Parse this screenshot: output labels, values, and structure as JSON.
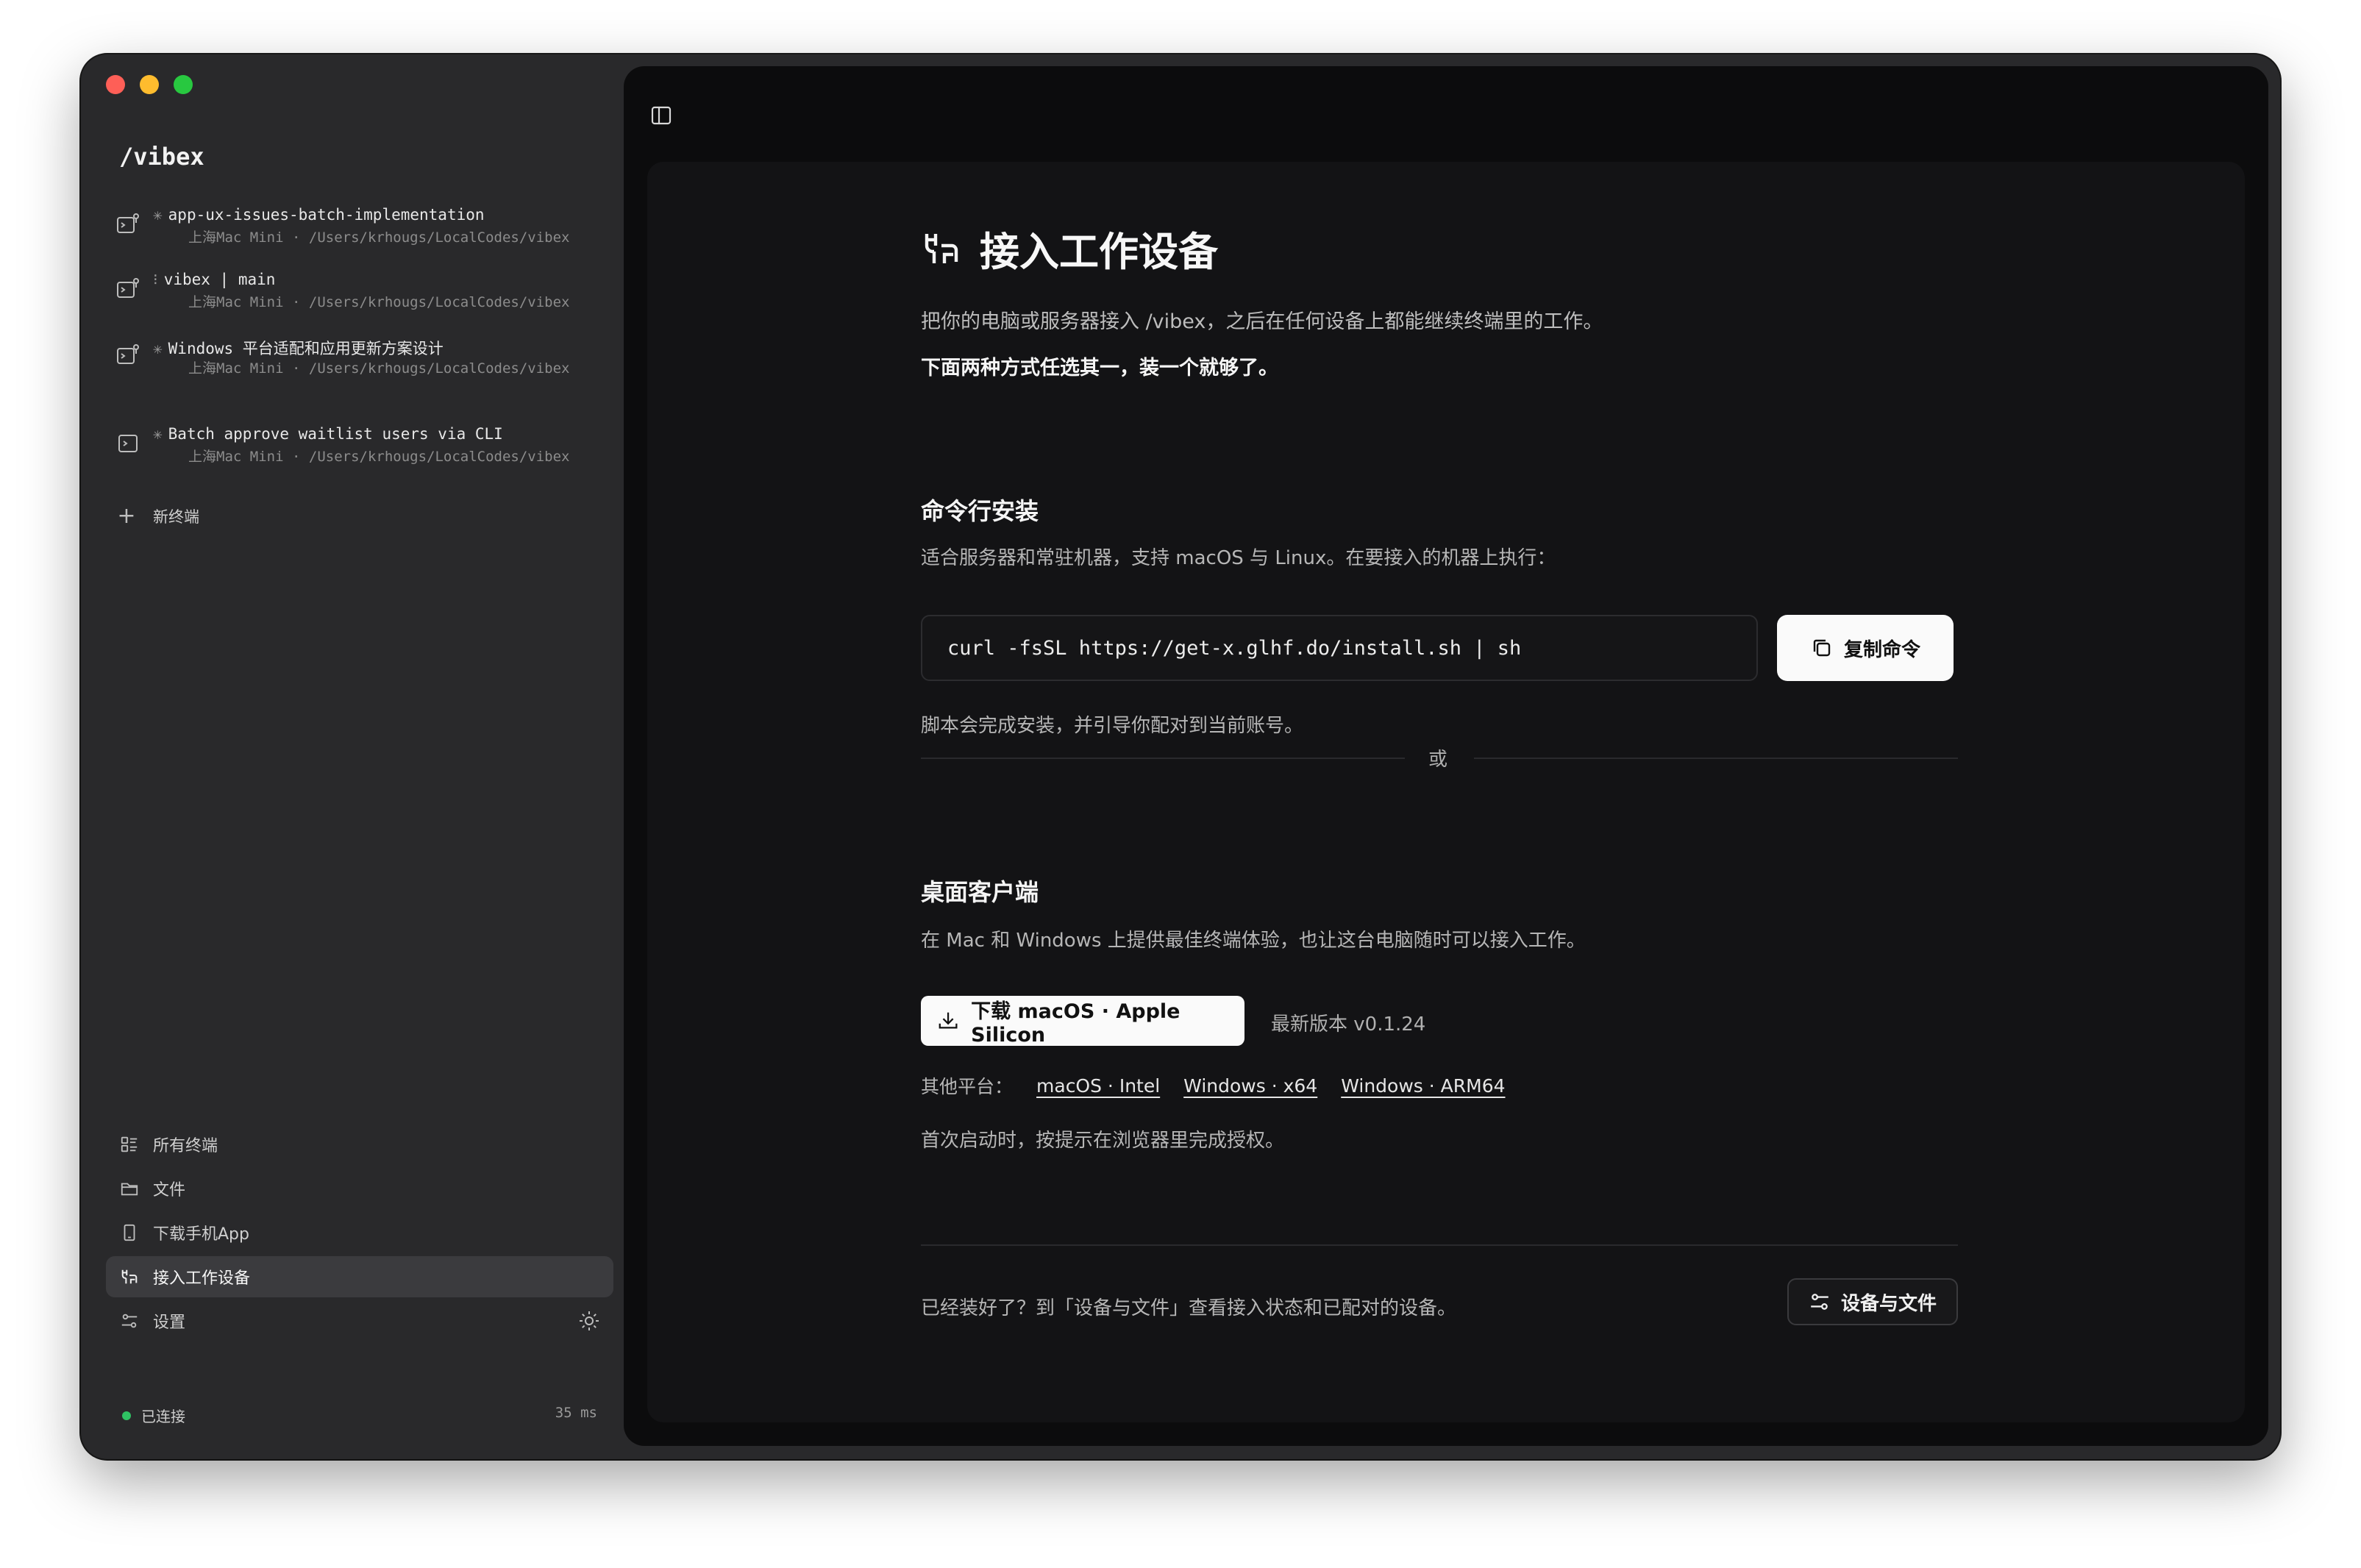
{
  "app": {
    "brand": "/vibex"
  },
  "sidebar": {
    "sessions": [
      {
        "icon": "terminal-branch-icon",
        "mark": "✳",
        "title": "app-ux-issues-batch-implementation",
        "host": "上海Mac Mini",
        "path": "/Users/krhougs/LocalCodes/vibex"
      },
      {
        "icon": "terminal-branch-icon",
        "mark": "⁝",
        "title": "vibex | main",
        "host": "上海Mac Mini",
        "path": "/Users/krhougs/LocalCodes/vibex"
      },
      {
        "icon": "terminal-branch-icon",
        "mark": "✳",
        "title": "Windows 平台适配和应用更新方案设计",
        "host": "上海Mac Mini",
        "path": "/Users/krhougs/LocalCodes/vibex"
      },
      {
        "icon": "terminal-icon",
        "mark": "✳",
        "title": "Batch approve waitlist users via CLI",
        "host": "上海Mac Mini",
        "path": "/Users/krhougs/LocalCodes/vibex"
      }
    ],
    "meta_separator": "·",
    "new_terminal": "新终端",
    "nav": [
      {
        "label": "所有终端",
        "icon": "list-icon"
      },
      {
        "label": "文件",
        "icon": "folder-icon"
      },
      {
        "label": "下载手机App",
        "icon": "phone-icon"
      },
      {
        "label": "接入工作设备",
        "icon": "connect-device-icon",
        "active": true
      },
      {
        "label": "设置",
        "icon": "settings-sliders-icon"
      }
    ],
    "status": {
      "label": "已连接",
      "latency": "35 ms",
      "color": "#2fc263"
    }
  },
  "main": {
    "title": "接入工作设备",
    "lead": "把你的电脑或服务器接入 /vibex，之后在任何设备上都能继续终端里的工作。",
    "lead_bold": "下面两种方式任选其一，装一个就够了。",
    "cli": {
      "title": "命令行安装",
      "desc": "适合服务器和常驻机器，支持 macOS 与 Linux。在要接入的机器上执行：",
      "command": "curl -fsSL https://get-x.glhf.do/install.sh | sh",
      "copy_label": "复制命令",
      "note": "脚本会完成安装，并引导你配对到当前账号。"
    },
    "or_label": "或",
    "desktop": {
      "title": "桌面客户端",
      "desc": "在 Mac 和 Windows 上提供最佳终端体验，也让这台电脑随时可以接入工作。",
      "download_label": "下载 macOS · Apple Silicon",
      "version_label": "最新版本 v0.1.24",
      "other_label": "其他平台：",
      "platforms": [
        "macOS · Intel",
        "Windows · x64",
        "Windows · ARM64"
      ],
      "note": "首次启动时，按提示在浏览器里完成授权。"
    },
    "footer": {
      "text": "已经装好了？到「设备与文件」查看接入状态和已配对的设备。",
      "button": "设备与文件"
    }
  }
}
